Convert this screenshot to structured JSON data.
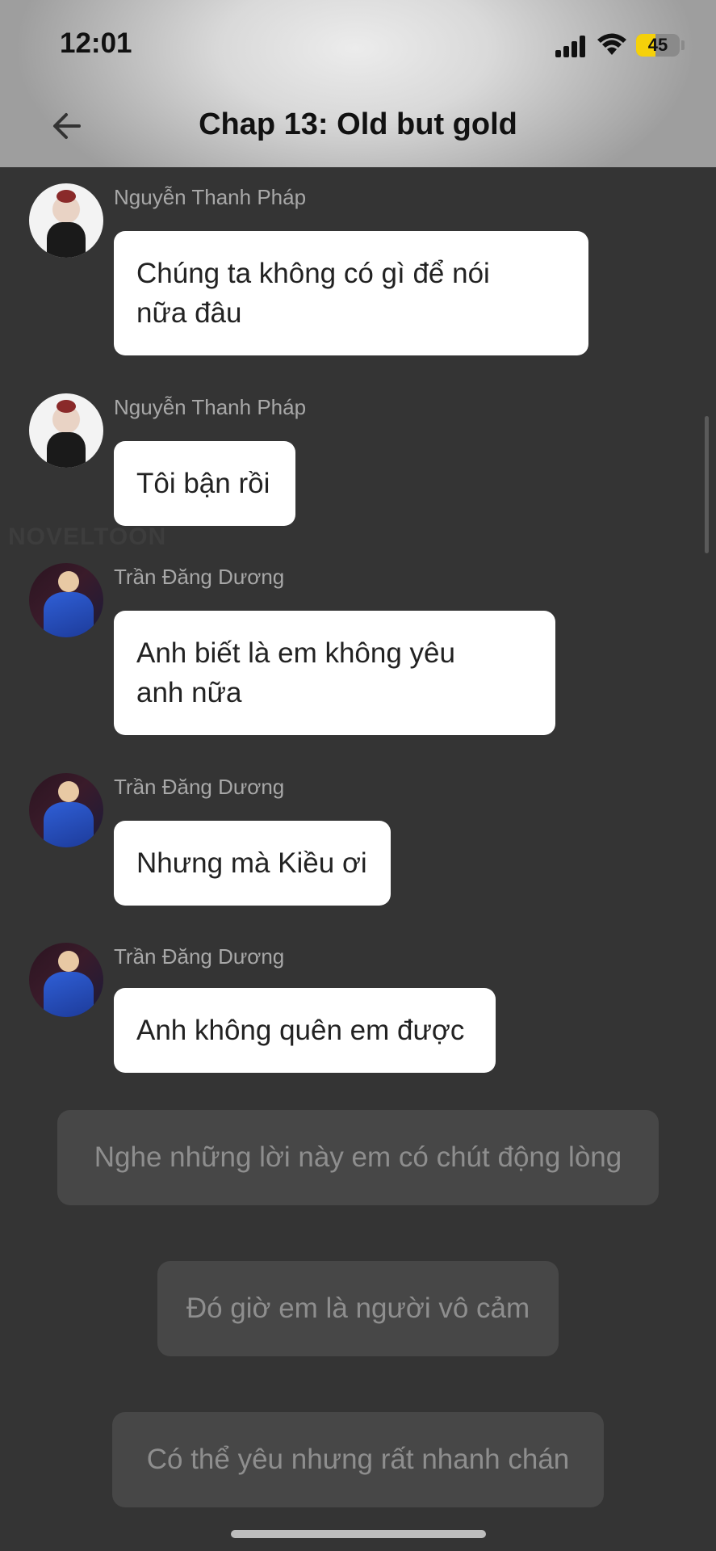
{
  "status_bar": {
    "time": "12:01",
    "battery_level": 45,
    "battery_text": "45",
    "battery_color": "#f5d10a"
  },
  "header": {
    "back_icon": "arrow-left-icon",
    "title": "Chap 13: Old but gold"
  },
  "watermark": "NOVELTOON",
  "messages": [
    {
      "sender": "Nguyễn Thanh Pháp",
      "text": "Chúng ta không có gì để nói\nnữa đâu",
      "avatar": "avatar-thanh-phap"
    },
    {
      "sender": "Nguyễn Thanh Pháp",
      "text": "Tôi bận rồi",
      "avatar": "avatar-thanh-phap"
    },
    {
      "sender": "Trần Đăng Dương",
      "text": "Anh biết là em không yêu\nanh nữa",
      "avatar": "avatar-dang-duong"
    },
    {
      "sender": "Trần Đăng Dương",
      "text": "Nhưng mà Kiều ơi",
      "avatar": "avatar-dang-duong"
    },
    {
      "sender": "Trần Đăng Dương",
      "text": "Anh không quên em được",
      "avatar": "avatar-dang-duong"
    }
  ],
  "choices": [
    "Nghe những lời này em có chút động lòng",
    "Đó giờ em là người vô cảm",
    "Có thể yêu nhưng rất nhanh chán"
  ]
}
